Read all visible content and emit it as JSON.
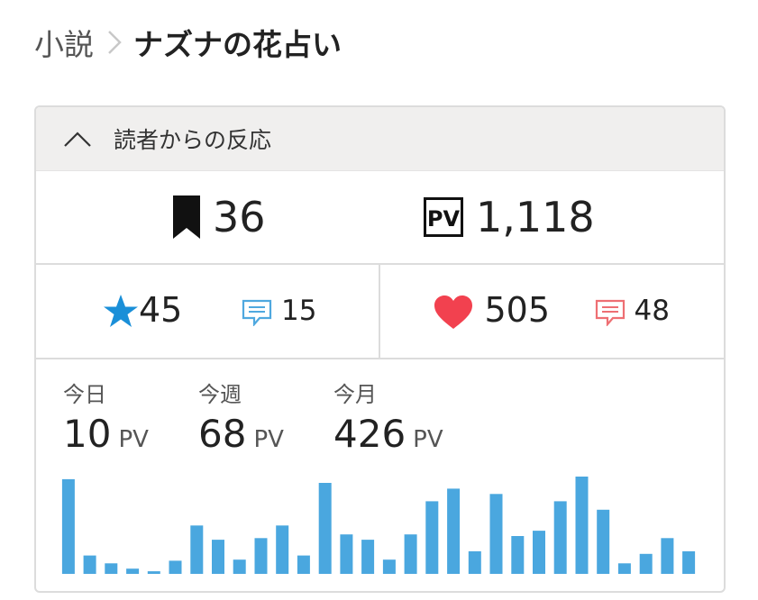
{
  "breadcrumb": {
    "parent": "小説",
    "current": "ナズナの花占い"
  },
  "reactions": {
    "title": "読者からの反応",
    "bookmarks": "36",
    "pv_badge": "PV",
    "pv_total": "1,118",
    "stars": "45",
    "star_comments": "15",
    "likes": "505",
    "like_comments": "48"
  },
  "stats": {
    "today_label": "今日",
    "today_value": "10",
    "week_label": "今週",
    "week_value": "68",
    "month_label": "今月",
    "month_value": "426",
    "unit": "PV"
  },
  "colors": {
    "star": "#1a8fd8",
    "star_comment": "#4fa8df",
    "heart": "#f2414f",
    "heart_comment": "#ee6f73",
    "bar": "#4aa7df"
  },
  "chart_data": {
    "type": "bar",
    "values": [
      18,
      3.5,
      2,
      1,
      0.5,
      2.5,
      9.2,
      6.5,
      2.7,
      6.8,
      9.2,
      3.5,
      17.3,
      7.5,
      6.5,
      2.7,
      7.5,
      13.8,
      16.2,
      4.3,
      15.2,
      7.2,
      8.2,
      13.8,
      18.5,
      12.2,
      2,
      3.8,
      6.8,
      4.3
    ],
    "ylim": [
      0,
      18.5
    ],
    "title": "",
    "xlabel": "",
    "ylabel": ""
  }
}
